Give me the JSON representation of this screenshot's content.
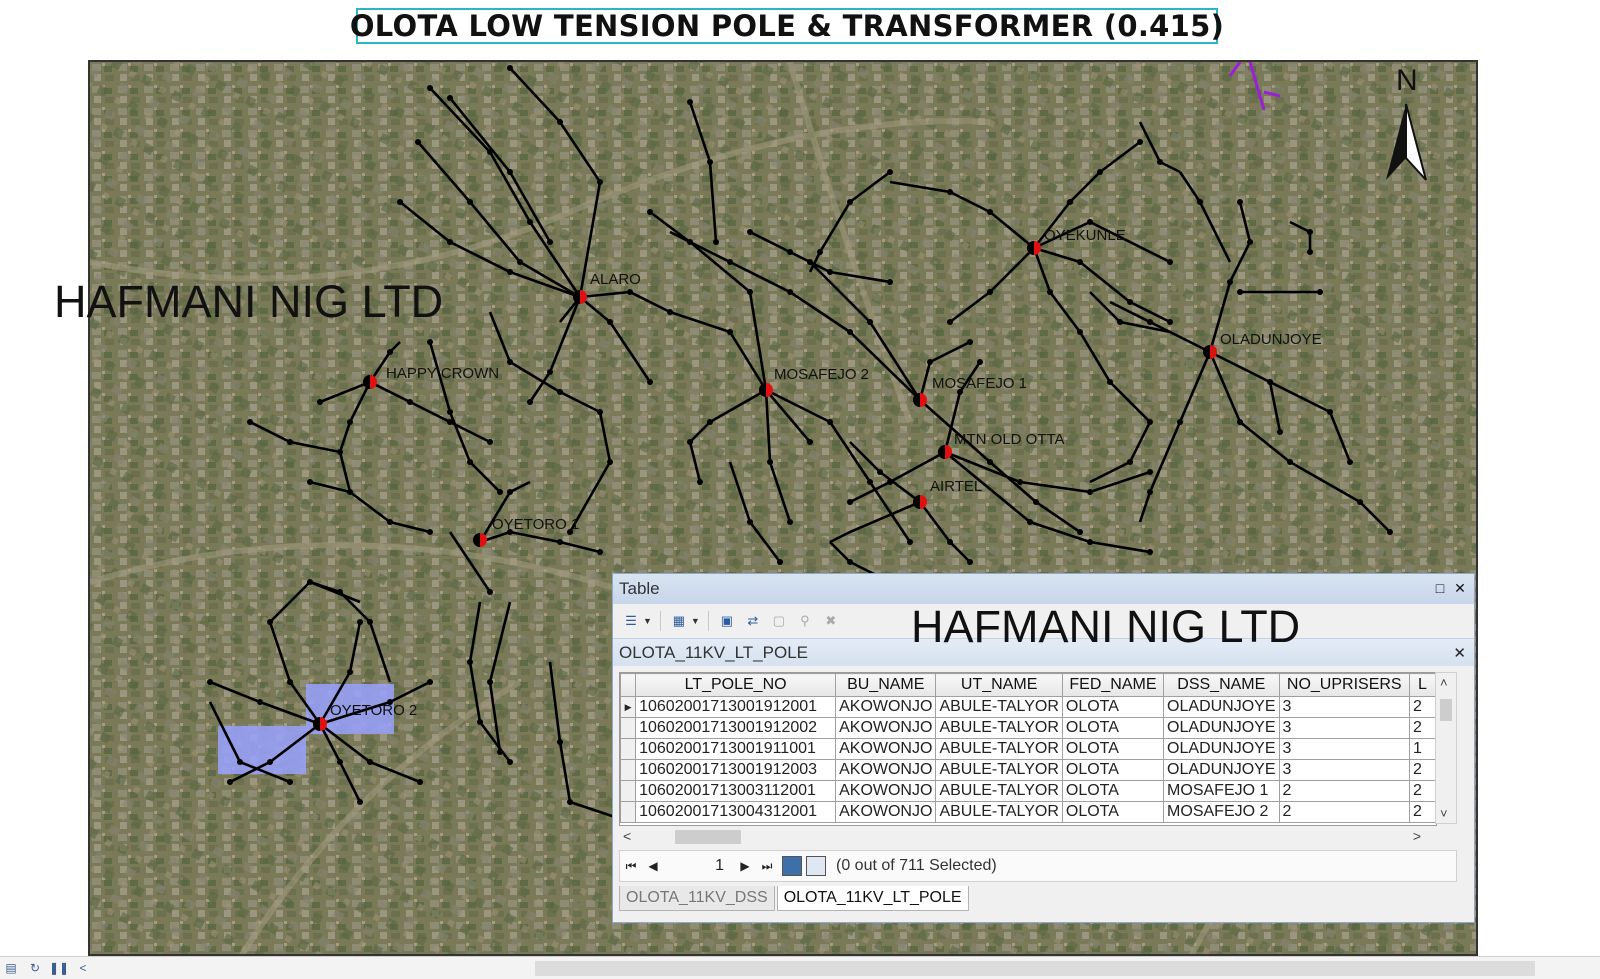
{
  "map_title": "OLOTA LOW TENSION POLE & TRANSFORMER (0.415)",
  "watermark": "HAFMANI NIG LTD",
  "north_label": "N",
  "transformer_labels": [
    "ALARO",
    "OYEKUNLE",
    "OLADUNJOYE",
    "HAPPY CROWN",
    "MOSAFEJO 2",
    "MOSAFEJO 1",
    "MTN OLD OTTA",
    "AIRTEL",
    "OYETORO 1",
    "OYETORO 2"
  ],
  "table_window": {
    "title": "Table",
    "layer_name": "OLOTA_11KV_LT_POLE",
    "columns": [
      "LT_POLE_NO",
      "BU_NAME",
      "UT_NAME",
      "FED_NAME",
      "DSS_NAME",
      "NO_UPRISERS",
      "L"
    ],
    "rows": [
      [
        "10602001713001912001",
        "AKOWONJO",
        "ABULE-TALYOR",
        "OLOTA",
        "OLADUNJOYE",
        "3",
        "2"
      ],
      [
        "10602001713001912002",
        "AKOWONJO",
        "ABULE-TALYOR",
        "OLOTA",
        "OLADUNJOYE",
        "3",
        "2"
      ],
      [
        "10602001713001911001",
        "AKOWONJO",
        "ABULE-TALYOR",
        "OLOTA",
        "OLADUNJOYE",
        "3",
        "1"
      ],
      [
        "10602001713001912003",
        "AKOWONJO",
        "ABULE-TALYOR",
        "OLOTA",
        "OLADUNJOYE",
        "3",
        "2"
      ],
      [
        "10602001713003112001",
        "AKOWONJO",
        "ABULE-TALYOR",
        "OLOTA",
        "MOSAFEJO 1",
        "2",
        "2"
      ],
      [
        "10602001713004312001",
        "AKOWONJO",
        "ABULE-TALYOR",
        "OLOTA",
        "MOSAFEJO 2",
        "2",
        "2"
      ]
    ],
    "current_record": "1",
    "selection_status": "(0 out of 711 Selected)",
    "tabs": [
      "OLOTA_11KV_DSS",
      "OLOTA_11KV_LT_POLE"
    ],
    "active_tab": "OLOTA_11KV_LT_POLE"
  },
  "colors": {
    "title_border": "#2ab6c6",
    "line": "#000000",
    "transformer_red": "#e01010",
    "imagery_base": "#7d7c5a",
    "feeder_purple": "#9b1fd6",
    "highlight_blue": "#9aa2ff"
  },
  "icons": [
    "north-arrow-icon",
    "table-options-icon",
    "related-tables-icon",
    "select-by-attributes-icon",
    "switch-selection-icon",
    "clear-selection-icon",
    "zoom-to-selected-icon",
    "delete-selected-icon",
    "first-record-icon",
    "previous-record-icon",
    "next-record-icon",
    "last-record-icon",
    "show-all-records-icon",
    "show-selected-records-icon"
  ]
}
